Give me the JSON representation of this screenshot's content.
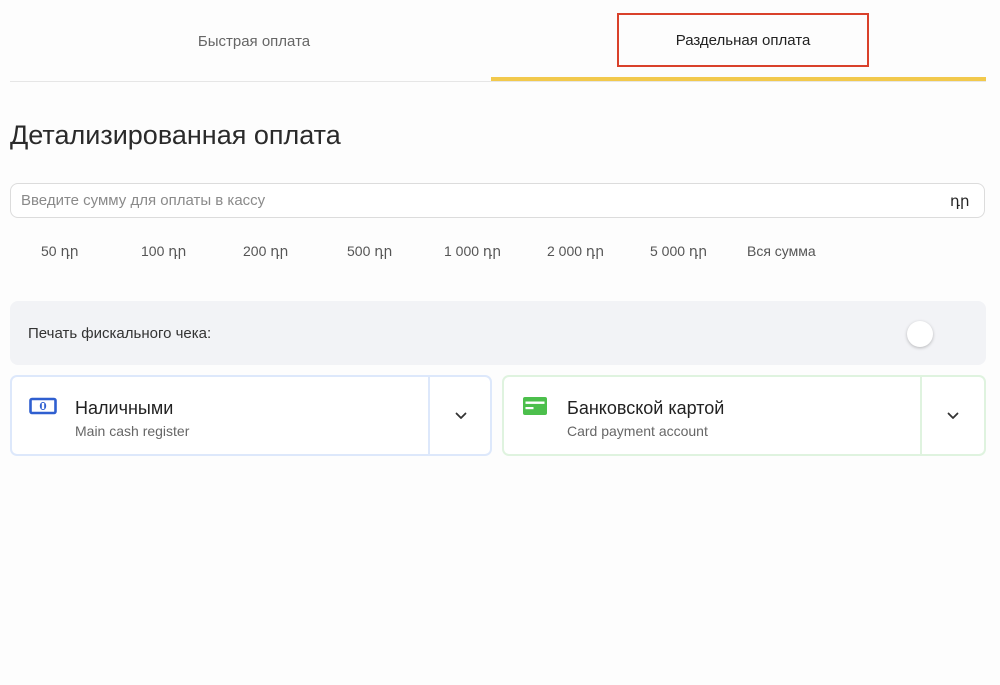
{
  "tabs": [
    {
      "label": "Быстрая оплата",
      "active": false
    },
    {
      "label": "Раздельная оплата",
      "active": true
    }
  ],
  "title": "Детализированная оплата",
  "amount_input": {
    "placeholder": "Введите сумму для оплаты в кассу",
    "value": "",
    "currency": "դր"
  },
  "quick_amounts": [
    "50 դր",
    "100 դր",
    "200 դր",
    "500 դր",
    "1 000 դր",
    "2 000 դր",
    "5 000 դր",
    "Вся сумма"
  ],
  "fiscal": {
    "label": "Печать фискального чека:",
    "enabled": false
  },
  "payment_methods": [
    {
      "title": "Наличными",
      "subtitle": "Main cash register",
      "icon": "banknote-icon",
      "accent": "#2f5fd0"
    },
    {
      "title": "Банковской картой",
      "subtitle": "Card payment account",
      "icon": "credit-card-icon",
      "accent": "#4cbf4c"
    }
  ],
  "colors": {
    "active_tab_underline": "#f2c94c",
    "highlight_box": "#d9412b"
  }
}
